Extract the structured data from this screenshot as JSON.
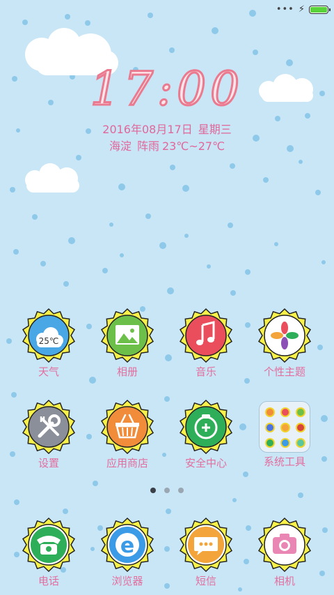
{
  "status_bar": {
    "signal": "•••",
    "charging_icon": "bolt-icon",
    "battery_level": 1.0,
    "battery_color": "#58d33a"
  },
  "clock": {
    "time": "17:00",
    "color": "#ea7a8f"
  },
  "date": {
    "date": "2016年08月17日",
    "weekday": "星期三",
    "location": "海淀",
    "weather": "阵雨",
    "temperature": "23℃~27℃"
  },
  "apps": [
    {
      "label": "天气",
      "icon": "weather-icon",
      "icon_text": "25℃",
      "color": "#4aa7e6"
    },
    {
      "label": "相册",
      "icon": "gallery-icon",
      "color": "#6cc04a"
    },
    {
      "label": "音乐",
      "icon": "music-icon",
      "color": "#ea4e5c"
    },
    {
      "label": "个性主题",
      "icon": "theme-icon",
      "color": "#ffffff"
    },
    {
      "label": "设置",
      "icon": "settings-icon",
      "color": "#8a8f99"
    },
    {
      "label": "应用商店",
      "icon": "store-icon",
      "color": "#f08c3a"
    },
    {
      "label": "安全中心",
      "icon": "security-icon",
      "color": "#2fae5a"
    },
    {
      "label": "系统工具",
      "icon": "folder-icon",
      "color": "#e7f1f7"
    }
  ],
  "page_indicator": {
    "count": 3,
    "active": 1
  },
  "dock": [
    {
      "label": "电话",
      "icon": "phone-icon",
      "color": "#2fae5a"
    },
    {
      "label": "浏览器",
      "icon": "browser-icon",
      "color": "#3b9be6"
    },
    {
      "label": "短信",
      "icon": "message-icon",
      "color": "#f3a43a"
    },
    {
      "label": "相机",
      "icon": "camera-icon",
      "color": "#ea86b4"
    }
  ]
}
